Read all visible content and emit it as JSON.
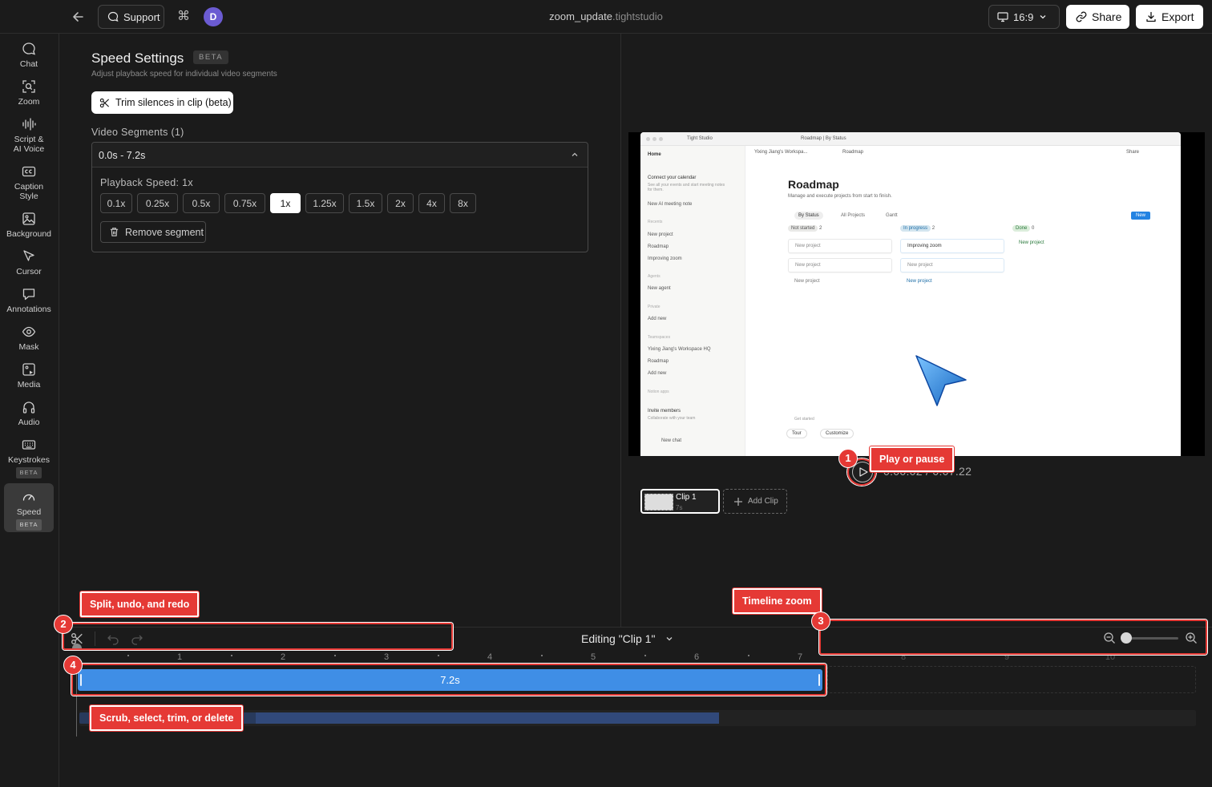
{
  "header": {
    "support_label": "Support",
    "cmd_glyph": "⌘",
    "avatar_letter": "D",
    "file_name": "zoom_update",
    "file_ext": ".tightstudio",
    "aspect_ratio": "16:9",
    "share_label": "Share",
    "export_label": "Export"
  },
  "sidebar": {
    "items": [
      {
        "label": "Chat",
        "icon": "chat-icon"
      },
      {
        "label": "Zoom",
        "icon": "zoom-icon"
      },
      {
        "label": "Script &",
        "label2": "AI Voice",
        "icon": "waveform-icon"
      },
      {
        "label": "Caption",
        "label2": "Style",
        "icon": "cc-icon"
      },
      {
        "label": "Background",
        "icon": "image-icon"
      },
      {
        "label": "Cursor",
        "icon": "cursor-icon"
      },
      {
        "label": "Annotations",
        "icon": "annotation-icon"
      },
      {
        "label": "Mask",
        "icon": "eye-icon"
      },
      {
        "label": "Media",
        "icon": "media-icon"
      },
      {
        "label": "Audio",
        "icon": "headphones-icon"
      },
      {
        "label": "Keystrokes",
        "badge": "BETA",
        "icon": "keyboard-icon"
      },
      {
        "label": "Speed",
        "badge": "BETA",
        "icon": "speedometer-icon",
        "active": true
      }
    ]
  },
  "speed_panel": {
    "title": "Speed Settings",
    "beta": "BETA",
    "subtitle": "Adjust playback speed for individual video segments",
    "trim_label": "Trim silences in clip (beta)",
    "segments_label": "Video Segments (1)",
    "segment_range": "0.0s - 7.2s",
    "playback_label": "Playback Speed: 1x",
    "speeds": [
      "0.1x",
      "0.25x",
      "0.5x",
      "0.75x",
      "1x",
      "1.25x",
      "1.5x",
      "2x",
      "4x",
      "8x"
    ],
    "selected_speed": "1x",
    "remove_label": "Remove segment"
  },
  "preview": {
    "tab_title": "Tight Studio",
    "page_tab": "Roadmap | By Status",
    "breadcrumb": "Yixing Jiang's Workspa...",
    "breadcrumb2": "Roadmap",
    "share_small": "Share",
    "sidebar_home": "Home",
    "connect_cal": "Connect your calendar",
    "connect_sub": "See all your events and start meeting notes for them.",
    "new_ai_note": "New AI meeting note",
    "recents_label": "Recents",
    "recents": [
      "New project",
      "Roadmap",
      "Improving zoom"
    ],
    "agents_label": "Agents",
    "new_agent": "New agent",
    "private_label": "Private",
    "add_new": "Add new",
    "teamspaces_label": "Teamspaces",
    "workspace_hq": "Yixing Jiang's Workspace HQ",
    "roadmap_item": "Roadmap",
    "add_new2": "Add new",
    "notion_apps": "Notion apps",
    "invite": "Invite members",
    "invite_sub": "Collaborate with your team",
    "new_chat": "New chat",
    "doc_title": "Roadmap",
    "doc_desc": "Manage and execute projects from start to finish.",
    "view_tabs": [
      "By Status",
      "All Projects",
      "Gantt"
    ],
    "new_btn": "New",
    "columns": [
      {
        "title": "Not started",
        "count": "2",
        "cards": [
          "New project",
          "New project"
        ],
        "add": "New project"
      },
      {
        "title": "In progress",
        "count": "2",
        "cards": [
          "Improving zoom",
          "New project"
        ],
        "add": "New project"
      },
      {
        "title": "Done",
        "count": "0",
        "cards": [],
        "add": "New project"
      }
    ],
    "get_started": "Get started",
    "tour": "Tour",
    "customize": "Customize"
  },
  "player": {
    "time": "0:00.02 / 0:07.22"
  },
  "clips": {
    "clip_name": "Clip 1",
    "clip_duration": "7s",
    "add_clip": "Add Clip"
  },
  "timeline": {
    "editing_label": "Editing \"Clip 1\"",
    "ruler": [
      "1",
      "2",
      "3",
      "4",
      "5",
      "6",
      "7",
      "8",
      "9",
      "10"
    ],
    "clip_duration": "7.2s"
  },
  "annotations": [
    {
      "num": "1",
      "text": "Play or pause"
    },
    {
      "num": "2",
      "text": "Split, undo, and redo"
    },
    {
      "num": "3",
      "text": "Timeline zoom"
    },
    {
      "num": "4",
      "text": "Scrub, select, trim, or delete"
    }
  ],
  "colors": {
    "accent_blue": "#3f8ee6",
    "annotation_red": "#e53935",
    "avatar_purple": "#6b5bd2"
  }
}
